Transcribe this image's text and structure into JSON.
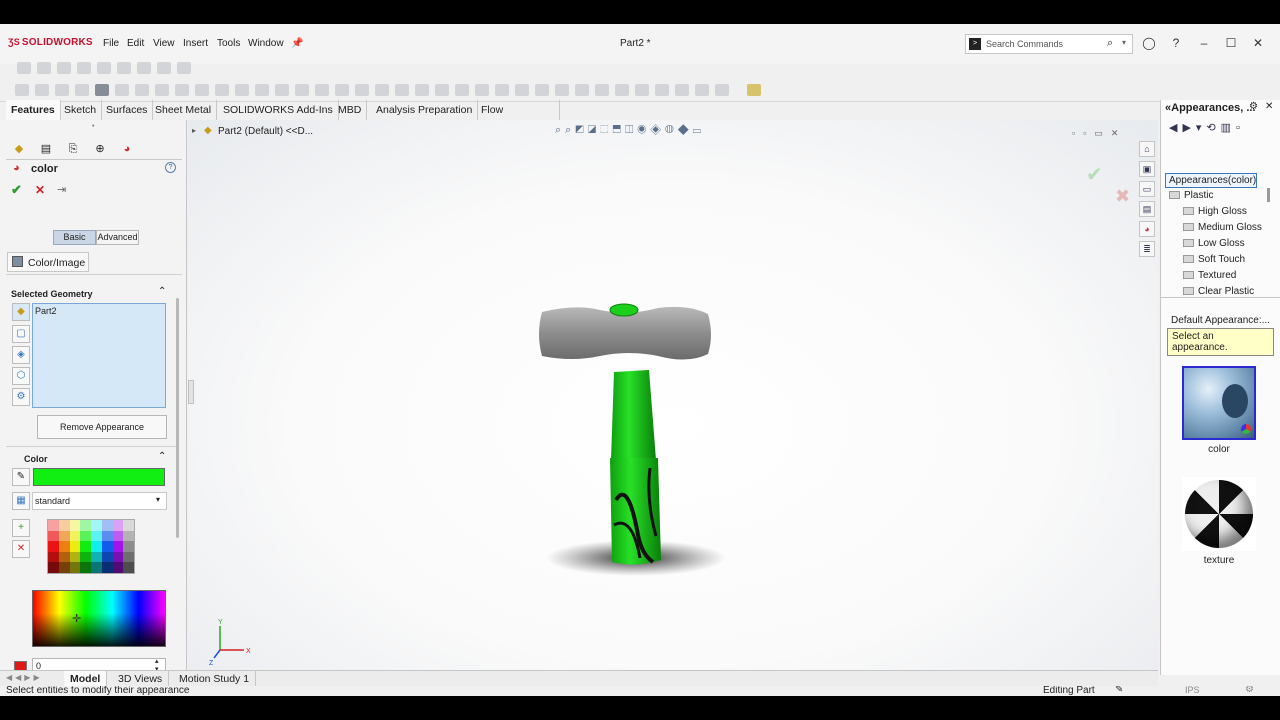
{
  "app": {
    "logo": "SOLIDWORKS",
    "doc_title": "Part2 *"
  },
  "menu": [
    "File",
    "Edit",
    "View",
    "Insert",
    "Tools",
    "Window"
  ],
  "search": {
    "placeholder": "Search Commands"
  },
  "command_tabs": [
    "Features",
    "Sketch",
    "Surfaces",
    "Sheet Metal",
    "SOLIDWORKS Add-Ins",
    "MBD",
    "Analysis Preparation",
    "Flow Simulation"
  ],
  "feature_tree": {
    "root_label": "Part2 (Default) <<D..."
  },
  "property_manager": {
    "title": "color",
    "mode_tabs": [
      "Basic",
      "Advanced"
    ],
    "color_image_tab": "Color/Image",
    "selected_geometry": {
      "header": "Selected Geometry",
      "items": [
        "Part2"
      ]
    },
    "remove_button": "Remove Appearance",
    "color": {
      "header": "Color",
      "current_color": "#11ee11",
      "palette_name": "standard",
      "value": "0"
    }
  },
  "appearances": {
    "title": "Appearances, ...",
    "tree": {
      "root": "Appearances(color)",
      "folder": "Plastic",
      "children": [
        "High Gloss",
        "Medium Gloss",
        "Low Gloss",
        "Soft Touch",
        "Textured",
        "Clear Plastic"
      ]
    },
    "default_header": "Default Appearance:...",
    "tooltip": "Select an appearance.",
    "thumbnails": [
      "color",
      "texture"
    ]
  },
  "bottom_tabs": [
    "Model",
    "3D Views",
    "Motion Study 1"
  ],
  "status": {
    "message": "Select entities to modify their appearance",
    "mode": "Editing Part",
    "units": "IPS"
  },
  "triad": {
    "y": "Y",
    "x": "X",
    "z": "Z"
  },
  "colors": {
    "accent_blue": "#1e63b6",
    "selection_fill": "#d4e8f8",
    "handle_green": "#16d416",
    "head_gray": "#8e8e8e"
  }
}
